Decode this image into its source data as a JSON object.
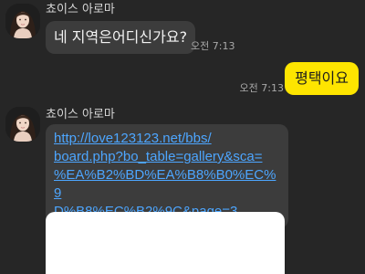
{
  "messages": [
    {
      "sender": "쵸이스 아로마",
      "text": "네 지역은어디신가요?",
      "time": "오전 7:13"
    },
    {
      "text": "평택이요",
      "time": "오전 7:13"
    },
    {
      "sender": "쵸이스 아로마",
      "link_lines": [
        "http://love123123.net/bbs/",
        "board.php?bo_table=gallery&sca=",
        "%EA%B2%BD%EA%B8%B0%EC%9",
        "D%B8%EC%B2%9C&page=3"
      ]
    }
  ],
  "icons": {
    "avatar": "profile-photo-icon"
  },
  "colors": {
    "background": "#262626",
    "incoming_bubble": "#3c3c3c",
    "outgoing_bubble": "#fee500",
    "link": "#4da6ff"
  }
}
